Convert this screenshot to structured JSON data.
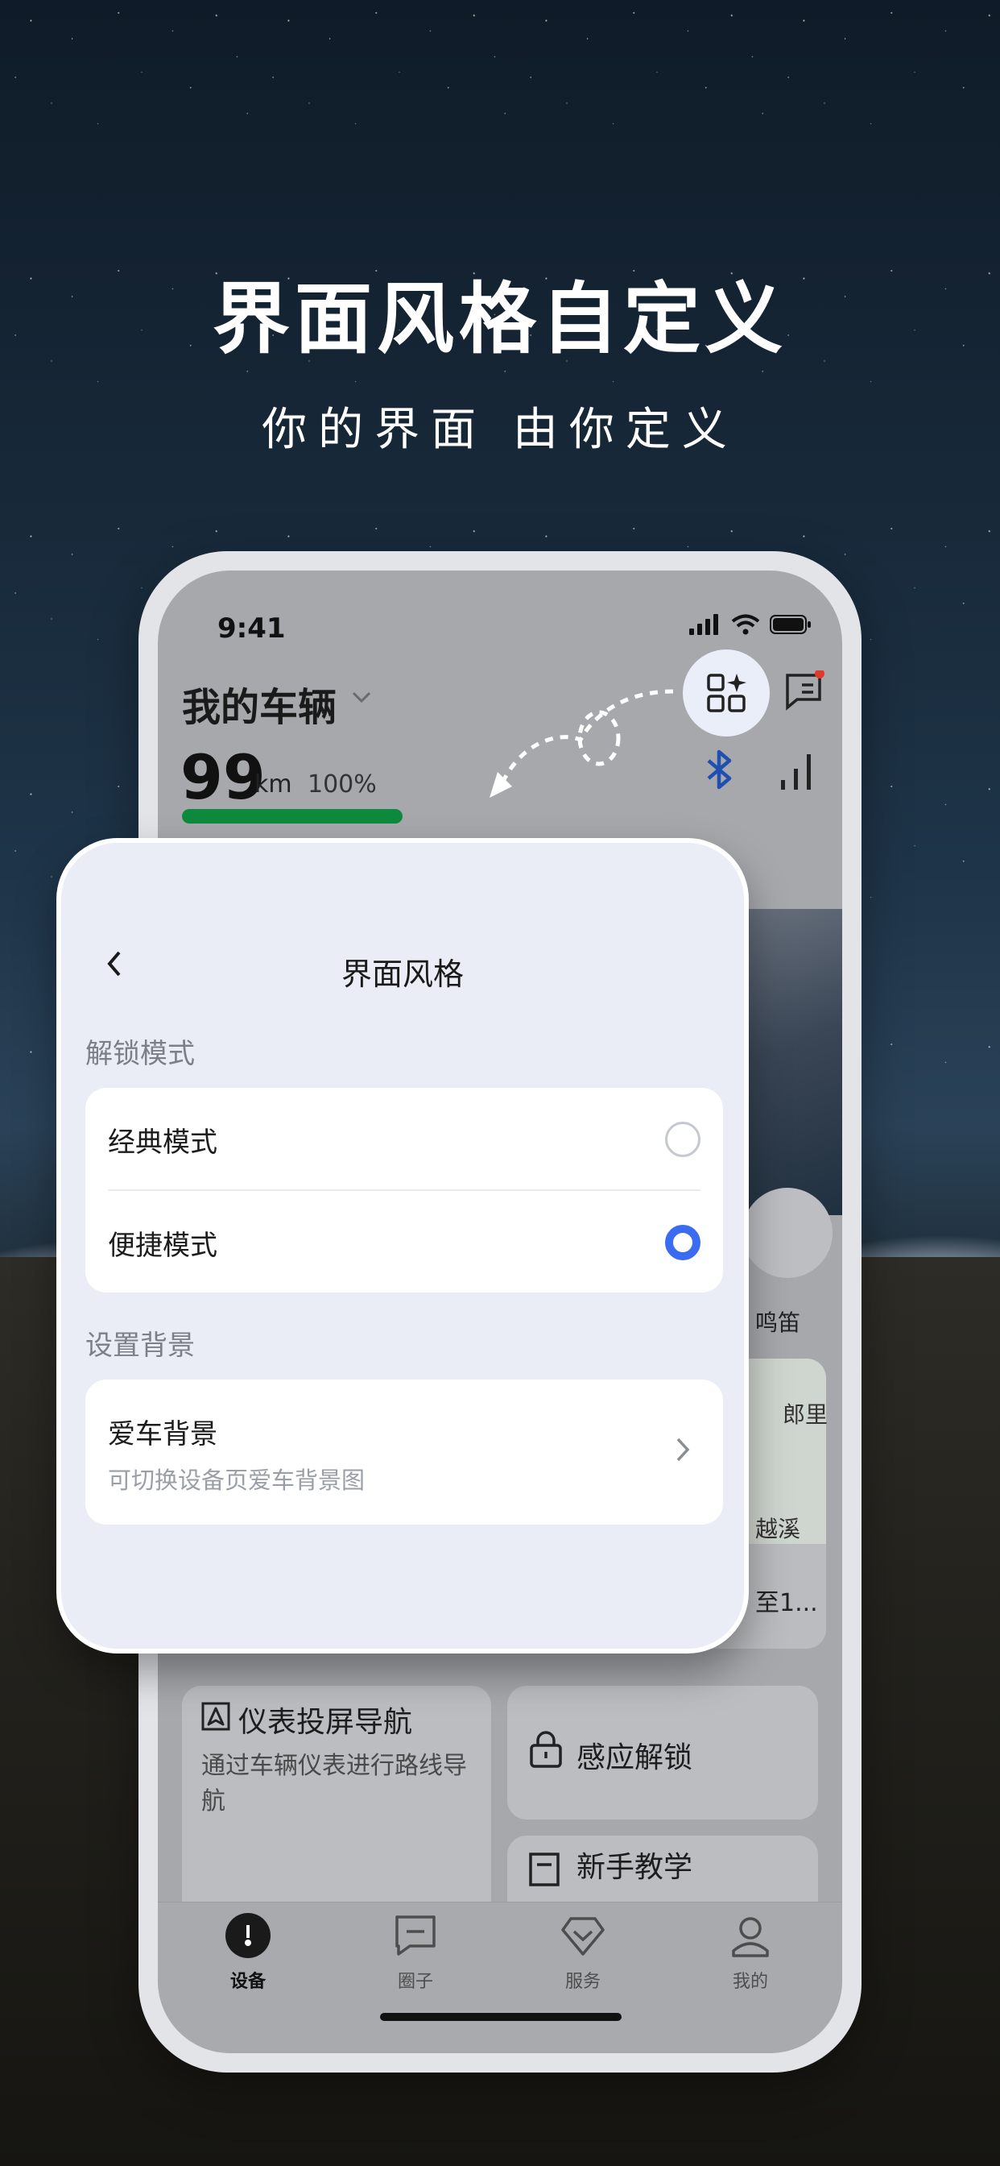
{
  "hero": {
    "title": "界面风格自定义",
    "subtitle": "你的界面  由你定义"
  },
  "status_bar": {
    "time": "9:41"
  },
  "home": {
    "vehicle_title": "我的车辆",
    "range_value": "99",
    "range_unit": "km",
    "battery_percent": "100%",
    "battery_level": 1.0,
    "horn_label": "鸣笛",
    "map_labels": [
      "郎里",
      "越溪",
      "至1..."
    ],
    "cards": {
      "dashboard_nav_title": "仪表投屏导航",
      "dashboard_nav_desc": "通过车辆仪表进行路线导航",
      "sensor_unlock_title": "感应解锁",
      "tutorial_title": "新手教学"
    }
  },
  "tabbar": {
    "items": [
      {
        "label": "设备",
        "icon": "gauge-icon",
        "active": true
      },
      {
        "label": "圈子",
        "icon": "chat-icon",
        "active": false
      },
      {
        "label": "服务",
        "icon": "diamond-icon",
        "active": false
      },
      {
        "label": "我的",
        "icon": "person-icon",
        "active": false
      }
    ]
  },
  "sheet": {
    "title": "界面风格",
    "unlock_section_label": "解锁模式",
    "modes": [
      {
        "label": "经典模式",
        "selected": false
      },
      {
        "label": "便捷模式",
        "selected": true
      }
    ],
    "background_section_label": "设置背景",
    "background_item_title": "爱车背景",
    "background_item_desc": "可切换设备页爱车背景图"
  },
  "colors": {
    "accent_blue": "#3a6bf0",
    "battery_green": "#0e8a3e",
    "bluetooth_blue": "#1f4fb0"
  }
}
